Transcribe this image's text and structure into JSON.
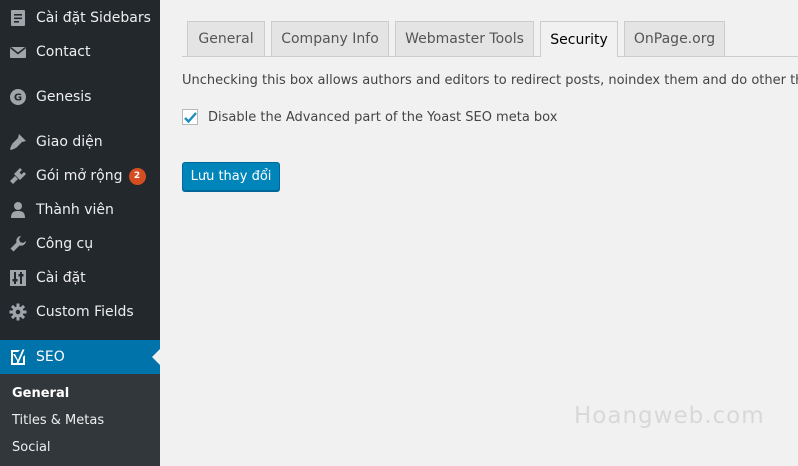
{
  "sidebar": {
    "items": [
      {
        "label": "Cài đặt Sidebars",
        "icon": "page-icon"
      },
      {
        "label": "Contact",
        "icon": "envelope-icon"
      },
      {
        "label": "Genesis",
        "icon": "genesis-icon"
      },
      {
        "label": "Giao diện",
        "icon": "brush-icon"
      },
      {
        "label": "Gói mở rộng",
        "icon": "plugin-icon",
        "badge": "2"
      },
      {
        "label": "Thành viên",
        "icon": "user-icon"
      },
      {
        "label": "Công cụ",
        "icon": "wrench-icon"
      },
      {
        "label": "Cài đặt",
        "icon": "settings-icon"
      },
      {
        "label": "Custom Fields",
        "icon": "gear-icon"
      },
      {
        "label": "SEO",
        "icon": "yoast-icon"
      }
    ],
    "submenu": [
      "General",
      "Titles & Metas",
      "Social"
    ]
  },
  "tabs": [
    {
      "label": "General"
    },
    {
      "label": "Company Info"
    },
    {
      "label": "Webmaster Tools"
    },
    {
      "label": "Security"
    },
    {
      "label": "OnPage.org"
    }
  ],
  "active_tab": "Security",
  "content": {
    "description": "Unchecking this box allows authors and editors to redirect posts, noindex them and do other things yo",
    "checkbox_label": "Disable the Advanced part of the Yoast SEO meta box",
    "checkbox_checked": true,
    "save_label": "Lưu thay đổi"
  },
  "watermark": "Hoangweb.com",
  "colors": {
    "sidebar_bg": "#23282d",
    "submenu_bg": "#32373c",
    "active_bg": "#0073aa",
    "button_bg": "#0085ba",
    "badge_bg": "#d54e21",
    "page_bg": "#f1f1f1"
  }
}
